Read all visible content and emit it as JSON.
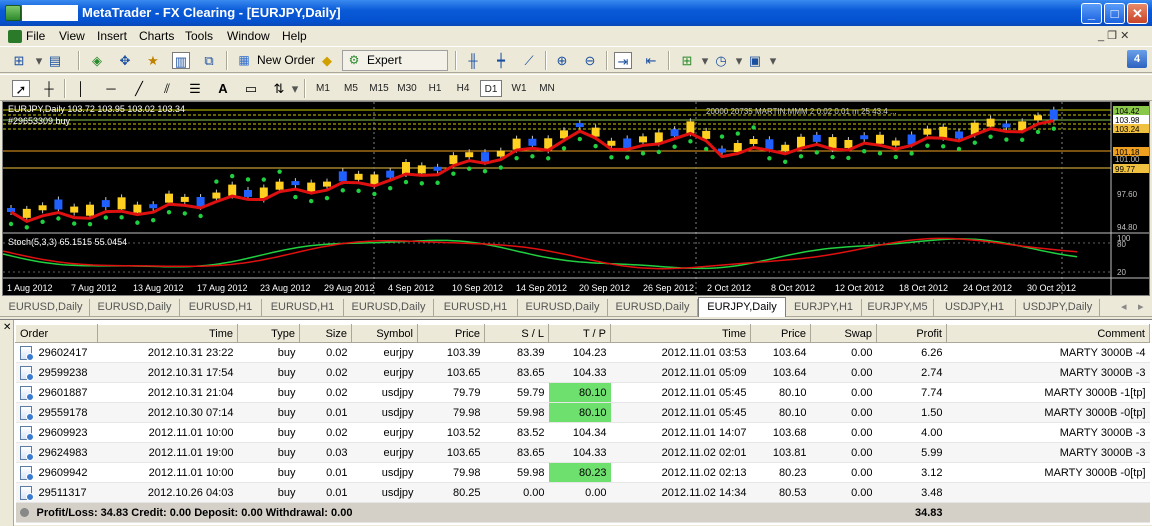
{
  "window": {
    "title": "MetaTrader - FX Clearing - [EURJPY,Daily]",
    "min_label": "_",
    "max_label": "□",
    "close_label": "✕"
  },
  "menu": {
    "items": [
      "File",
      "View",
      "Insert",
      "Charts",
      "Tools",
      "Window",
      "Help"
    ],
    "restore_label": "_ ❐ ✕"
  },
  "toolbar": {
    "new_order": "New Order",
    "expert_advisors": "Expert Advisors",
    "timeframes": [
      "M1",
      "M5",
      "M15",
      "M30",
      "H1",
      "H4",
      "D1",
      "W1",
      "MN"
    ],
    "active_timeframe": "D1",
    "help_badge": "4"
  },
  "chart": {
    "header": "EURJPY,Daily  103.72 103.95 103.02 103.34",
    "order_label": "#29653309 buy",
    "right_info": "20000 20735 MARTIN.MMM 2 0.02 0.01  m 25 43.4 ...",
    "price_tags": [
      "104.42",
      "103.98",
      "103.24",
      "101.18",
      "101.00",
      "99.77",
      "97.60",
      "94.80"
    ],
    "stoch_label": "Stoch(5,3,3) 65.1515 55.0454",
    "stoch_levels": [
      "100",
      "80",
      "20"
    ],
    "dates": [
      "1 Aug 2012",
      "7 Aug 2012",
      "13 Aug 2012",
      "17 Aug 2012",
      "23 Aug 2012",
      "29 Aug 2012",
      "4 Sep 2012",
      "10 Sep 2012",
      "14 Sep 2012",
      "20 Sep 2012",
      "26 Sep 2012",
      "2 Oct 2012",
      "8 Oct 2012",
      "12 Oct 2012",
      "18 Oct 2012",
      "24 Oct 2012",
      "30 Oct 2012"
    ],
    "colors": {
      "bull": "#2060ff",
      "bear": "#ffd020",
      "ma": "#e01010",
      "sar": "#20d040",
      "stoch_main": "#20d040",
      "stoch_signal": "#e01010"
    }
  },
  "chart_tabs": [
    "EURUSD,Daily",
    "EURUSD,Daily",
    "EURUSD,H1",
    "EURUSD,H1",
    "EURUSD,Daily",
    "EURUSD,H1",
    "EURUSD,Daily",
    "EURUSD,Daily",
    "EURJPY,Daily",
    "EURJPY,H1",
    "EURJPY,M5",
    "USDJPY,H1",
    "USDJPY,Daily"
  ],
  "active_chart_tab": 8,
  "terminal": {
    "columns": [
      "Order",
      "Time",
      "Type",
      "Size",
      "Symbol",
      "Price",
      "S / L",
      "T / P",
      "Time",
      "Price",
      "Swap",
      "Profit",
      "Comment"
    ],
    "rows": [
      {
        "order": "29602417",
        "time": "2012.10.31 23:22",
        "type": "buy",
        "size": "0.02",
        "symbol": "eurjpy",
        "price": "103.39",
        "sl": "83.39",
        "tp": "104.23",
        "ctime": "2012.11.01 03:53",
        "cprice": "103.64",
        "swap": "0.00",
        "profit": "6.26",
        "comment": "MARTY 3000B -4",
        "tp_hl": false
      },
      {
        "order": "29599238",
        "time": "2012.10.31 17:54",
        "type": "buy",
        "size": "0.02",
        "symbol": "eurjpy",
        "price": "103.65",
        "sl": "83.65",
        "tp": "104.33",
        "ctime": "2012.11.01 05:09",
        "cprice": "103.64",
        "swap": "0.00",
        "profit": "2.74",
        "comment": "MARTY 3000B -3",
        "tp_hl": false
      },
      {
        "order": "29601887",
        "time": "2012.10.31 21:04",
        "type": "buy",
        "size": "0.02",
        "symbol": "usdjpy",
        "price": "79.79",
        "sl": "59.79",
        "tp": "80.10",
        "ctime": "2012.11.01 05:45",
        "cprice": "80.10",
        "swap": "0.00",
        "profit": "7.74",
        "comment": "MARTY 3000B -1[tp]",
        "tp_hl": true
      },
      {
        "order": "29559178",
        "time": "2012.10.30 07:14",
        "type": "buy",
        "size": "0.01",
        "symbol": "usdjpy",
        "price": "79.98",
        "sl": "59.98",
        "tp": "80.10",
        "ctime": "2012.11.01 05:45",
        "cprice": "80.10",
        "swap": "0.00",
        "profit": "1.50",
        "comment": "MARTY 3000B -0[tp]",
        "tp_hl": true
      },
      {
        "order": "29609923",
        "time": "2012.11.01 10:00",
        "type": "buy",
        "size": "0.02",
        "symbol": "eurjpy",
        "price": "103.52",
        "sl": "83.52",
        "tp": "104.34",
        "ctime": "2012.11.01 14:07",
        "cprice": "103.68",
        "swap": "0.00",
        "profit": "4.00",
        "comment": "MARTY 3000B -3",
        "tp_hl": false
      },
      {
        "order": "29624983",
        "time": "2012.11.01 19:00",
        "type": "buy",
        "size": "0.03",
        "symbol": "eurjpy",
        "price": "103.65",
        "sl": "83.65",
        "tp": "104.33",
        "ctime": "2012.11.02 02:01",
        "cprice": "103.81",
        "swap": "0.00",
        "profit": "5.99",
        "comment": "MARTY 3000B -3",
        "tp_hl": false
      },
      {
        "order": "29609942",
        "time": "2012.11.01 10:00",
        "type": "buy",
        "size": "0.01",
        "symbol": "usdjpy",
        "price": "79.98",
        "sl": "59.98",
        "tp": "80.23",
        "ctime": "2012.11.02 02:13",
        "cprice": "80.23",
        "swap": "0.00",
        "profit": "3.12",
        "comment": "MARTY 3000B -0[tp]",
        "tp_hl": true
      },
      {
        "order": "29511317",
        "time": "2012.10.26 04:03",
        "type": "buy",
        "size": "0.01",
        "symbol": "usdjpy",
        "price": "80.25",
        "sl": "0.00",
        "tp": "0.00",
        "ctime": "2012.11.02 14:34",
        "cprice": "80.53",
        "swap": "0.00",
        "profit": "3.48",
        "comment": "",
        "tp_hl": false
      }
    ],
    "summary_text": "Profit/Loss: 34.83  Credit: 0.00  Deposit: 0.00  Withdrawal: 0.00",
    "summary_total": "34.83"
  }
}
